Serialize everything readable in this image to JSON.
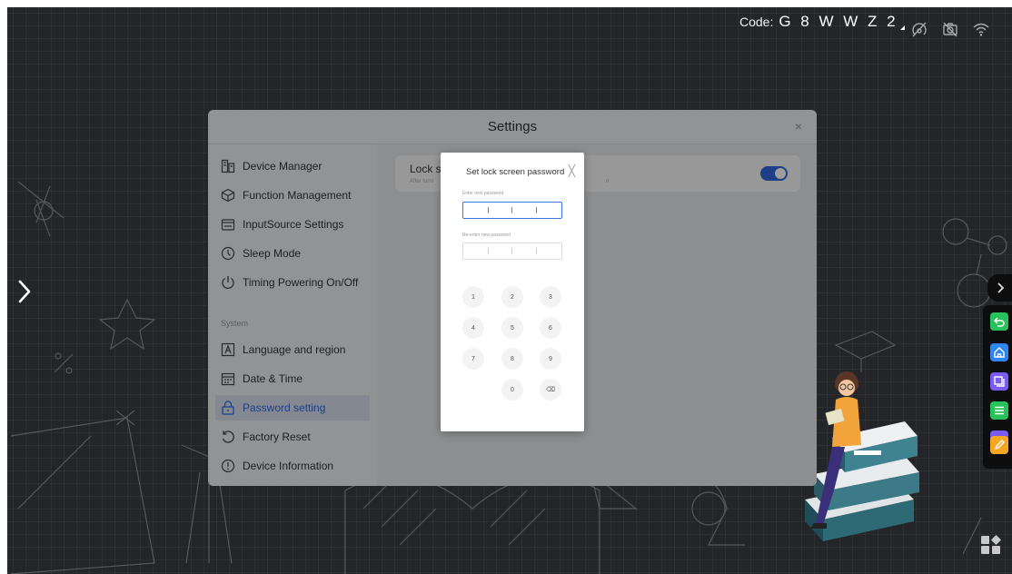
{
  "topbar": {
    "code_label": "Code:",
    "code_value": "G 8 W W Z 2",
    "icons": [
      "cast-icon",
      "camera-off-icon",
      "wifi-icon"
    ]
  },
  "settings": {
    "title": "Settings",
    "close_glyph": "×",
    "menu": [
      {
        "label": "Device Manager",
        "icon": "device-manager-icon"
      },
      {
        "label": "Function Management",
        "icon": "cube-icon"
      },
      {
        "label": "InputSource Settings",
        "icon": "input-source-icon"
      },
      {
        "label": "Sleep Mode",
        "icon": "clock-icon"
      },
      {
        "label": "Timing Powering On/Off",
        "icon": "power-icon"
      }
    ],
    "section_label": "System",
    "system_menu": [
      {
        "label": "Language and region",
        "icon": "language-icon"
      },
      {
        "label": "Date & Time",
        "icon": "calendar-icon"
      },
      {
        "label": "Password setting",
        "icon": "lock-icon",
        "active": true
      },
      {
        "label": "Factory Reset",
        "icon": "reset-icon"
      },
      {
        "label": "Device Information",
        "icon": "info-icon"
      }
    ],
    "lock_row": {
      "title": "Lock sc",
      "subtitle": "After turni",
      "subtitle_tail": "n",
      "toggle_on": true
    }
  },
  "password_dialog": {
    "title": "Set lock screen password",
    "close_glyph": "╳",
    "new_label": "Enter new password",
    "reenter_label": "Re-enter new password",
    "keys": [
      "1",
      "2",
      "3",
      "4",
      "5",
      "6",
      "7",
      "8",
      "9",
      "0"
    ],
    "backspace_glyph": "⌫"
  },
  "colors": {
    "accent": "#2f66d7",
    "background": "#232528",
    "toolbar_green": "#27c25b",
    "toolbar_blue": "#2f86f0",
    "toolbar_purple": "#7a5af0",
    "toolbar_orange": "#f5a623"
  }
}
